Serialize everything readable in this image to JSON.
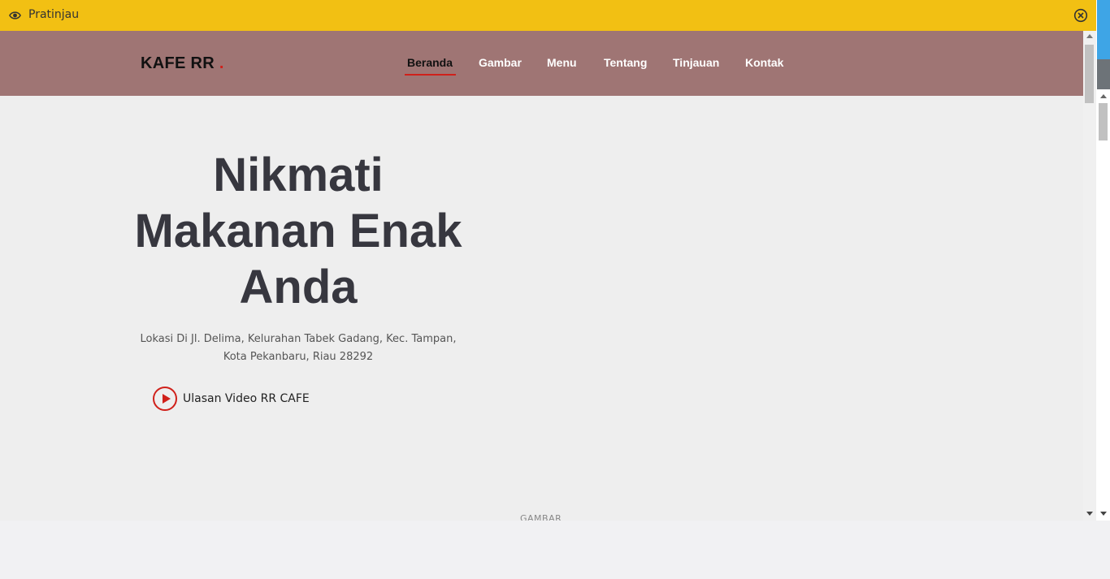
{
  "preview_bar": {
    "label": "Pratinjau",
    "eye_icon": "eye-icon",
    "close_icon": "close-circle-icon",
    "color": "#f2c013"
  },
  "site": {
    "logo_text": "KAFE RR",
    "logo_dot": ".",
    "header_color": "#9f7574",
    "accent_color": "#d0201a",
    "nav": [
      {
        "label": "Beranda",
        "active": true
      },
      {
        "label": "Gambar",
        "active": false
      },
      {
        "label": "Menu",
        "active": false
      },
      {
        "label": "Tentang",
        "active": false
      },
      {
        "label": "Tinjauan",
        "active": false
      },
      {
        "label": "Kontak",
        "active": false
      }
    ]
  },
  "hero": {
    "title_lines": [
      "Nikmati",
      "Makanan Enak",
      "Anda"
    ],
    "subtitle_lines": [
      "Lokasi Di Jl. Delima, Kelurahan Tabek Gadang, Kec. Tampan,",
      "Kota Pekanbaru, Riau 28292"
    ],
    "video_label": "Ulasan Video RR CAFE",
    "video_icon": "play-circle-icon"
  },
  "section_label": "GAMBAR"
}
